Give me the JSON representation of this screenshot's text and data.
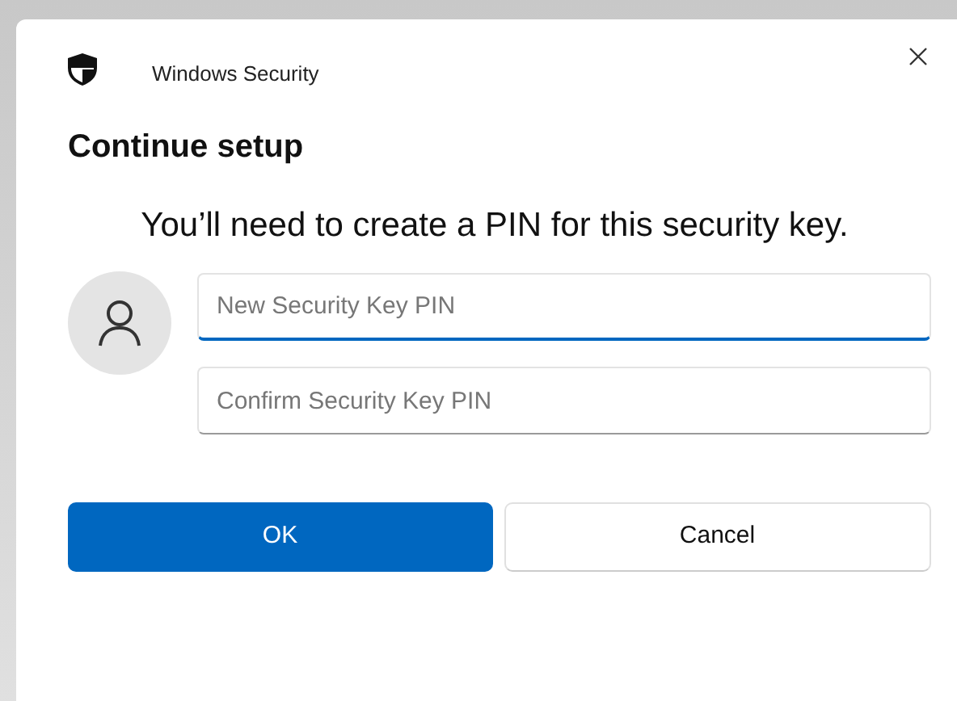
{
  "window": {
    "title": "Windows Security"
  },
  "heading": "Continue setup",
  "message": "You’ll need to create a PIN for this security key.",
  "fields": [
    {
      "placeholder": "New Security Key PIN",
      "focused": true
    },
    {
      "placeholder": "Confirm Security Key PIN",
      "focused": false
    }
  ],
  "buttons": [
    {
      "label": "OK",
      "primary": true
    },
    {
      "label": "Cancel",
      "primary": false
    }
  ]
}
